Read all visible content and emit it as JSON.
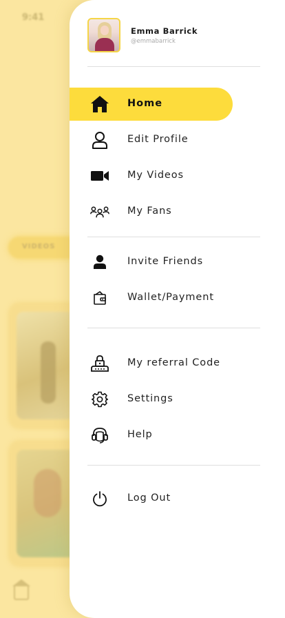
{
  "background_app": {
    "status_time": "9:41",
    "tab_pill": "VIDEOS"
  },
  "profile": {
    "name": "Emma Barrick",
    "handle": "@emmabarrick"
  },
  "menu": {
    "primary": [
      {
        "label": "Home",
        "icon": "home-icon",
        "active": true
      },
      {
        "label": "Edit Profile",
        "icon": "user-outline-icon"
      },
      {
        "label": "My Videos",
        "icon": "video-camera-icon"
      },
      {
        "label": "My Fans",
        "icon": "group-icon"
      }
    ],
    "secondary": [
      {
        "label": "Invite Friends",
        "icon": "person-icon"
      },
      {
        "label": "Wallet/Payment",
        "icon": "wallet-icon"
      }
    ],
    "tertiary": [
      {
        "label": "My referral Code",
        "icon": "referral-code-icon"
      },
      {
        "label": "Settings",
        "icon": "gear-icon"
      },
      {
        "label": "Help",
        "icon": "headset-icon"
      }
    ],
    "footer": [
      {
        "label": "Log Out",
        "icon": "power-icon"
      }
    ]
  },
  "colors": {
    "accent": "#fddc3c",
    "background_overlay": "#fbe6a0",
    "drawer": "#ffffff",
    "text": "#222222",
    "divider": "#dedede"
  }
}
